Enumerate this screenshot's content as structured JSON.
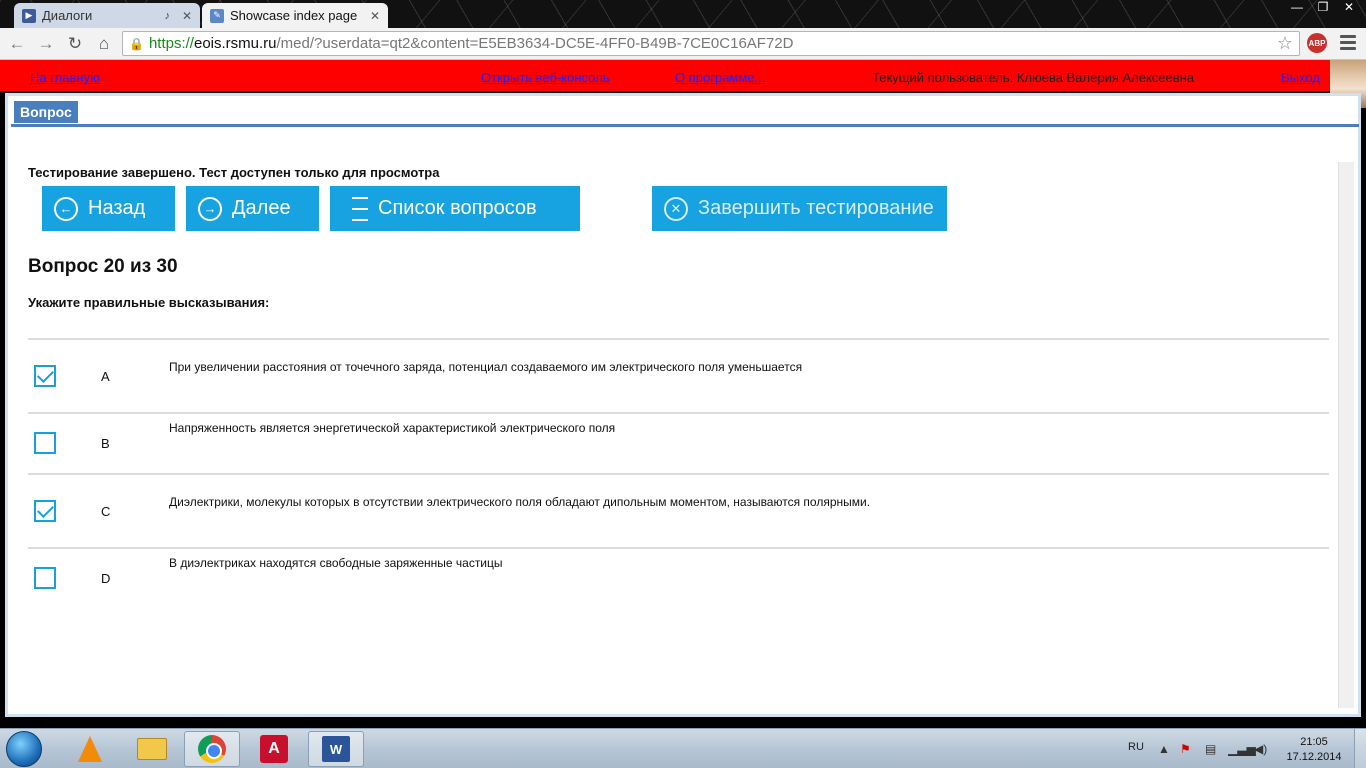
{
  "browser": {
    "tabs": [
      {
        "label": "Диалоги",
        "icon": "media-icon"
      },
      {
        "label": "Showcase index page",
        "icon": "page-icon"
      }
    ],
    "url": {
      "scheme": "https://",
      "host": "eois.rsmu.ru",
      "path": "/med/?userdata=qt2&content=E5EB3634-DC5E-4FF0-B49B-7CE0C16AF72D"
    },
    "extension_label": "ABP"
  },
  "header": {
    "home_link": "На главную",
    "console_link": "Открыть веб-консоль",
    "about_link": "О программе...",
    "current_user": "Текущий пользователь: Клюева Валерия Алексеевна",
    "logout_link": "Выход"
  },
  "panel": {
    "tab_label": "Вопрос",
    "status": "Тестирование завершено. Тест доступен только для просмотра",
    "buttons": {
      "back": "Назад",
      "next": "Далее",
      "list": "Список вопросов",
      "finish": "Завершить тестирование"
    },
    "question_title": "Вопрос 20 из 30",
    "question_prompt": "Укажите правильные высказывания:",
    "answers": [
      {
        "letter": "A",
        "text": "При увеличении расстояния от точечного заряда, потенциал создаваемого им электрического поля уменьшается",
        "checked": true
      },
      {
        "letter": "B",
        "text": "Напряженность является энергетической характеристикой электрического поля",
        "checked": false
      },
      {
        "letter": "C",
        "text": "Диэлектрики, молекулы которых в отсутствии электрического поля обладают дипольным моментом, называются полярными.",
        "checked": true
      },
      {
        "letter": "D",
        "text": "В диэлектриках находятся свободные заряженные частицы",
        "checked": false
      }
    ]
  },
  "taskbar": {
    "language": "RU",
    "time": "21:05",
    "date": "17.12.2014"
  },
  "colors": {
    "header_bg": "#ff0000",
    "button_bg": "#17a3e1",
    "tab_accent": "#4a7fbf",
    "checkbox": "#1aa0d8"
  }
}
